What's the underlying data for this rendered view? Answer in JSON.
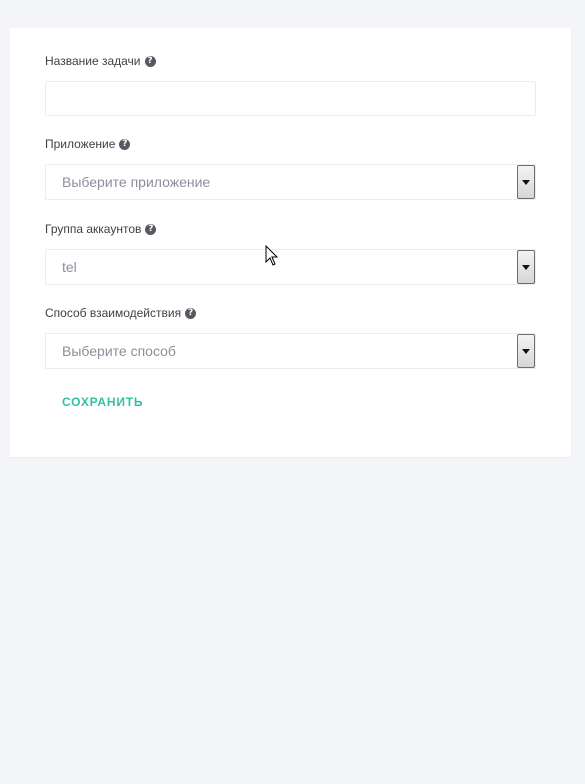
{
  "form": {
    "task_name": {
      "label": "Название задачи",
      "value": "",
      "help_icon": "question-circle-icon"
    },
    "application": {
      "label": "Приложение",
      "selected": "Выберите приложение",
      "help_icon": "question-circle-icon"
    },
    "account_group": {
      "label": "Группа аккаунтов",
      "selected": "tel",
      "help_icon": "question-circle-icon"
    },
    "interaction_method": {
      "label": "Способ взаимодействия",
      "selected": "Выберите способ",
      "help_icon": "question-circle-icon"
    },
    "save_label": "СОХРАНИТЬ"
  },
  "colors": {
    "page_background": "#f4f5f9",
    "card_background": "#ffffff",
    "accent": "#34bfa3",
    "label_text": "#3f4047",
    "placeholder_text": "#8c8f9c"
  }
}
